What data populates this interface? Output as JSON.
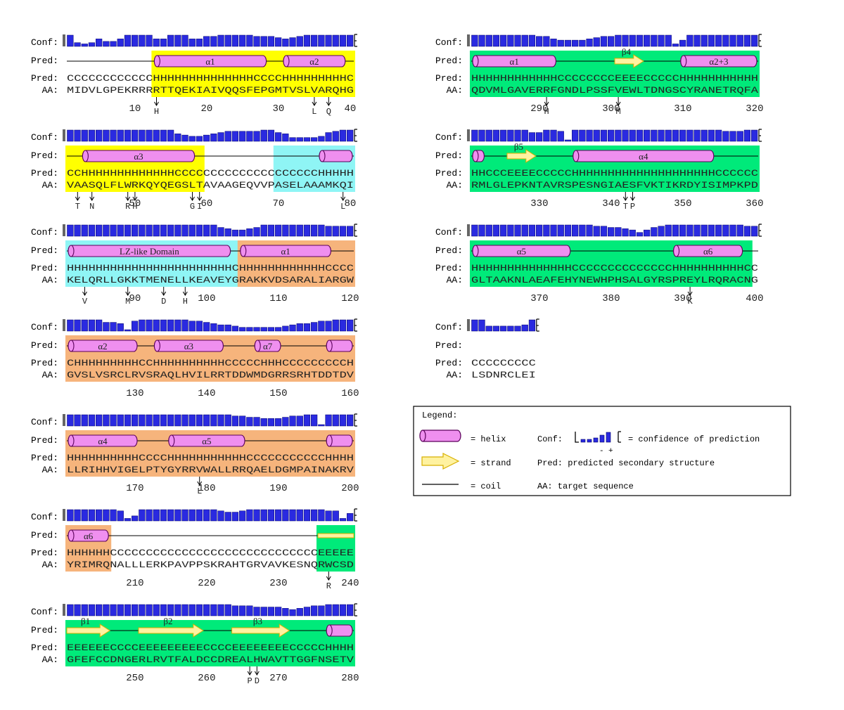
{
  "labels": {
    "conf": "Conf:",
    "pred": "Pred:",
    "aa": "AA:"
  },
  "colors": {
    "bar": "#2a2ae0",
    "bar_edge": "#00006a",
    "helix_fill": "#ef8fef",
    "helix_edge": "#5a005a",
    "strand_fill": "#fff2a0",
    "strand_edge": "#d8b000",
    "green": "#00ea7a",
    "orange": "#f6b47c",
    "yellow": "#ffff00",
    "cyan": "#8ff5f5"
  },
  "blocks": [
    {
      "start": 1,
      "ss": "CCCCCCCCCCCCHHHHHHHHHHHHHHCCCCHHHHHHHHHC",
      "aa": "MIDVLGPEKRRRRTTQEKIAIVQQSFEPGMTVSLVARQHG",
      "conf": [
        9,
        3,
        2,
        3,
        6,
        4,
        4,
        6,
        9,
        9,
        9,
        9,
        6,
        6,
        9,
        9,
        9,
        6,
        6,
        8,
        8,
        9,
        9,
        9,
        9,
        9,
        8,
        8,
        8,
        7,
        6,
        7,
        8,
        9,
        9,
        9,
        9,
        9,
        9,
        9
      ],
      "ticks": [
        10,
        20,
        30,
        40
      ],
      "bg": [
        {
          "from": 13,
          "to": 40,
          "color": "yellow"
        }
      ],
      "helices": [
        {
          "from": 13,
          "to": 28,
          "label": "α1"
        },
        {
          "from": 31,
          "to": 39,
          "label": "α2"
        }
      ],
      "strands": [],
      "marks": [
        {
          "pos": 13,
          "label": "H"
        },
        {
          "pos": 35,
          "label": "L"
        },
        {
          "pos": 37,
          "label": "Q"
        }
      ]
    },
    {
      "start": 41,
      "ss": "CCHHHHHHHHHHHHHCCCCCCCCCCCCCCCCCCCCHHHHH",
      "aa": "VAASQLFLWRKQYQEGSLTAVAAGEQVVPASELAAAMKQI",
      "conf": [
        9,
        9,
        9,
        9,
        9,
        9,
        9,
        9,
        9,
        9,
        9,
        9,
        9,
        9,
        9,
        6,
        5,
        4,
        4,
        5,
        6,
        7,
        8,
        8,
        8,
        8,
        8,
        9,
        9,
        7,
        6,
        3,
        3,
        3,
        3,
        4,
        7,
        8,
        9,
        9
      ],
      "ticks": [
        50,
        60,
        70,
        80
      ],
      "bg": [
        {
          "from": 41,
          "to": 59,
          "color": "yellow"
        },
        {
          "from": 70,
          "to": 80,
          "color": "cyan"
        }
      ],
      "helices": [
        {
          "from": 43,
          "to": 58,
          "label": "α3"
        },
        {
          "from": 76,
          "to": 80,
          "label": ""
        }
      ],
      "strands": [],
      "marks": [
        {
          "pos": 42,
          "label": "T"
        },
        {
          "pos": 44,
          "label": "N"
        },
        {
          "pos": 49,
          "label": "R"
        },
        {
          "pos": 50,
          "label": "H"
        },
        {
          "pos": 58,
          "label": "G"
        },
        {
          "pos": 59,
          "label": "I"
        },
        {
          "pos": 79,
          "label": "L"
        }
      ]
    },
    {
      "start": 81,
      "ss": "HHHHHHHHHHHHHHHHHHHHHHHCHHHHHHHHHHHHCCCC",
      "aa": "KELQRLLGKKTMENELLKEAVEYGRAKKVDSARALIARGW",
      "conf": [
        9,
        9,
        9,
        9,
        9,
        9,
        9,
        9,
        9,
        9,
        9,
        9,
        9,
        9,
        9,
        9,
        9,
        9,
        9,
        9,
        9,
        7,
        6,
        5,
        5,
        6,
        7,
        9,
        9,
        9,
        9,
        9,
        9,
        9,
        9,
        9,
        8,
        8,
        8,
        8
      ],
      "ticks": [
        90,
        100,
        110,
        120
      ],
      "bg": [
        {
          "from": 81,
          "to": 104,
          "color": "cyan"
        },
        {
          "from": 105,
          "to": 120,
          "color": "orange"
        }
      ],
      "helices": [
        {
          "from": 81,
          "to": 103,
          "label": "LZ-like Domain"
        },
        {
          "from": 105,
          "to": 117,
          "label": "α1"
        }
      ],
      "strands": [],
      "marks": [
        {
          "pos": 83,
          "label": "V"
        },
        {
          "pos": 89,
          "label": "M"
        },
        {
          "pos": 94,
          "label": "D"
        },
        {
          "pos": 97,
          "label": "H"
        }
      ]
    },
    {
      "start": 121,
      "ss": "CHHHHHHHHHCCHHHHHHHHHHCCCCCHHHCCCCCCCCCH",
      "aa": "GVSLVSRCLRVSRAQLHVILRRTDDWMDGRRSRHTDDTDV",
      "conf": [
        9,
        9,
        9,
        9,
        9,
        7,
        7,
        6,
        1,
        8,
        9,
        9,
        9,
        9,
        9,
        9,
        9,
        8,
        8,
        7,
        6,
        5,
        5,
        4,
        3,
        3,
        3,
        3,
        3,
        3,
        4,
        5,
        6,
        6,
        7,
        8,
        8,
        9,
        9,
        9
      ],
      "ticks": [
        130,
        140,
        150,
        160
      ],
      "bg": [
        {
          "from": 121,
          "to": 160,
          "color": "orange"
        }
      ],
      "helices": [
        {
          "from": 121,
          "to": 130,
          "label": "α2"
        },
        {
          "from": 133,
          "to": 142,
          "label": "α3"
        },
        {
          "from": 147,
          "to": 150,
          "label": "α7"
        },
        {
          "from": 157,
          "to": 160,
          "label": ""
        }
      ],
      "strands": [],
      "marks": []
    },
    {
      "start": 161,
      "ss": "HHHHHHHHHHCCCCHHHHHHHHHHHCCCCCCCCCCCHHHH",
      "aa": "LLRIHHVIGELPTYGYRRVWALLRRQAELDGMPAINAKRV",
      "conf": [
        9,
        9,
        9,
        9,
        9,
        9,
        9,
        9,
        9,
        9,
        9,
        9,
        9,
        9,
        9,
        9,
        9,
        9,
        9,
        9,
        9,
        9,
        9,
        8,
        8,
        7,
        7,
        6,
        6,
        6,
        7,
        8,
        8,
        9,
        9,
        1,
        9,
        9,
        9,
        9
      ],
      "ticks": [
        170,
        180,
        190,
        200
      ],
      "bg": [
        {
          "from": 161,
          "to": 200,
          "color": "orange"
        }
      ],
      "helices": [
        {
          "from": 161,
          "to": 170,
          "label": "α4"
        },
        {
          "from": 175,
          "to": 185,
          "label": "α5"
        },
        {
          "from": 197,
          "to": 200,
          "label": ""
        }
      ],
      "strands": [],
      "marks": [
        {
          "pos": 179,
          "label": "L"
        }
      ]
    },
    {
      "start": 201,
      "ss": "HHHHHHCCCCCCCCCCCCCCCCCCCCCCCCCCCCCEEEEE",
      "aa": "YRIMRQNALLLERKPAVPPSKRAHTGRVAVKESNQRWCSD",
      "conf": [
        9,
        9,
        9,
        9,
        9,
        9,
        9,
        8,
        2,
        4,
        9,
        9,
        9,
        9,
        9,
        9,
        9,
        9,
        9,
        9,
        9,
        8,
        7,
        7,
        8,
        9,
        9,
        9,
        9,
        9,
        9,
        9,
        9,
        9,
        9,
        9,
        8,
        8,
        2,
        6
      ],
      "ticks": [
        210,
        220,
        230,
        240
      ],
      "bg": [
        {
          "from": 201,
          "to": 206,
          "color": "orange"
        },
        {
          "from": 236,
          "to": 240,
          "color": "green"
        }
      ],
      "helices": [
        {
          "from": 201,
          "to": 206,
          "label": "α6"
        }
      ],
      "strands": [
        {
          "from": 236,
          "to": 240,
          "label": ""
        }
      ],
      "marks": [
        {
          "pos": 237,
          "label": "R"
        }
      ]
    },
    {
      "start": 241,
      "ss": "EEEEEECCCCEEEEEEEEECCCCEEEEEEEECCCCCHHHH",
      "aa": "GFEFCCDNGERLRVTFALDCCDREALHWAVTTGGFNSETV",
      "conf": [
        9,
        9,
        9,
        9,
        9,
        9,
        9,
        9,
        9,
        9,
        9,
        9,
        9,
        9,
        9,
        9,
        9,
        9,
        9,
        9,
        9,
        9,
        9,
        8,
        8,
        8,
        7,
        7,
        7,
        7,
        6,
        5,
        6,
        7,
        8,
        8,
        9,
        9,
        9,
        9
      ],
      "ticks": [
        250,
        260,
        270,
        280
      ],
      "bg": [
        {
          "from": 241,
          "to": 280,
          "color": "green"
        }
      ],
      "helices": [
        {
          "from": 277,
          "to": 280,
          "label": ""
        }
      ],
      "strands": [
        {
          "from": 241,
          "to": 246,
          "label": "β1"
        },
        {
          "from": 251,
          "to": 259,
          "label": "β2"
        },
        {
          "from": 264,
          "to": 271,
          "label": "β3"
        }
      ],
      "marks": [
        {
          "pos": 266,
          "label": "P"
        },
        {
          "pos": 267,
          "label": "D"
        }
      ]
    },
    {
      "start": 281,
      "ss": "HHHHHHHHHHHHCCCCCCCCEEEECCCCCHHHHHHHHHHH",
      "aa": "QDVMLGAVERRFGNDLPSSFVEWLTDNGSCYRANETRQFA",
      "conf": [
        9,
        9,
        9,
        9,
        9,
        9,
        9,
        9,
        9,
        8,
        8,
        6,
        5,
        5,
        5,
        5,
        6,
        7,
        8,
        8,
        9,
        9,
        9,
        9,
        9,
        9,
        9,
        9,
        2,
        5,
        9,
        9,
        9,
        9,
        9,
        9,
        9,
        9,
        9,
        9
      ],
      "ticks": [
        290,
        300,
        310,
        320
      ],
      "bg": [
        {
          "from": 281,
          "to": 320,
          "color": "green"
        }
      ],
      "helices": [
        {
          "from": 281,
          "to": 292,
          "label": "α1"
        },
        {
          "from": 310,
          "to": 320,
          "label": "α2+3"
        }
      ],
      "strands": [
        {
          "from": 301,
          "to": 304,
          "label": "β4"
        }
      ],
      "marks": [
        {
          "pos": 291,
          "label": "H"
        },
        {
          "pos": 301,
          "label": "M"
        }
      ]
    },
    {
      "start": 321,
      "ss": "HHCCCEEEECCCCCHHHHHHHHHHHHHHHHHHHHCCCCCC",
      "aa": "RMLGLEPKNTAVRSPESNGIAESFVKTIKRDYISIMPKPD",
      "conf": [
        9,
        9,
        9,
        9,
        9,
        9,
        9,
        9,
        7,
        7,
        9,
        9,
        8,
        1,
        9,
        9,
        9,
        9,
        9,
        9,
        9,
        9,
        9,
        9,
        9,
        9,
        9,
        9,
        9,
        9,
        9,
        9,
        9,
        9,
        9,
        8,
        8,
        8,
        9,
        9
      ],
      "ticks": [
        330,
        340,
        350,
        360
      ],
      "bg": [
        {
          "from": 321,
          "to": 360,
          "color": "green"
        }
      ],
      "helices": [
        {
          "from": 321,
          "to": 322,
          "label": ""
        },
        {
          "from": 335,
          "to": 354,
          "label": "α4"
        }
      ],
      "strands": [
        {
          "from": 326,
          "to": 329,
          "label": "β5"
        }
      ],
      "marks": [
        {
          "pos": 342,
          "label": "T"
        },
        {
          "pos": 343,
          "label": "P"
        }
      ]
    },
    {
      "start": 361,
      "ss": "HHHHHHHHHHHHHHCCCCCCCCCCCCCCHHHHHHHHHHCC",
      "aa": "GLTAAKNLAEAFEHYNEWHPHSALGYRSPREYLRQRACNG",
      "conf": [
        9,
        9,
        9,
        9,
        9,
        9,
        9,
        9,
        9,
        9,
        9,
        9,
        9,
        9,
        9,
        9,
        9,
        8,
        8,
        7,
        7,
        6,
        5,
        3,
        5,
        7,
        8,
        9,
        9,
        9,
        9,
        9,
        9,
        9,
        9,
        9,
        9,
        9,
        8,
        8
      ],
      "ticks": [
        370,
        380,
        390,
        400
      ],
      "bg": [
        {
          "from": 361,
          "to": 399,
          "color": "green"
        }
      ],
      "helices": [
        {
          "from": 361,
          "to": 374,
          "label": "α5"
        },
        {
          "from": 389,
          "to": 398,
          "label": "α6"
        }
      ],
      "strands": [],
      "marks": [
        {
          "pos": 391,
          "label": "K"
        }
      ]
    },
    {
      "start": 401,
      "ss": "CCCCCCCCC",
      "aa": "LSDNRCLEI",
      "conf": [
        9,
        9,
        4,
        4,
        4,
        4,
        4,
        5,
        9
      ],
      "ticks": [],
      "bg": [],
      "helices": [],
      "strands": [],
      "marks": []
    }
  ],
  "legend": {
    "title": "Legend:",
    "helix": "= helix",
    "strand": "= strand",
    "coil": "= coil",
    "conf_prefix": "Conf:",
    "conf_desc": "= confidence of prediction",
    "minus": "-",
    "plus": "+",
    "pred_desc": "Pred: predicted secondary structure",
    "aa_desc": "AA: target sequence"
  }
}
